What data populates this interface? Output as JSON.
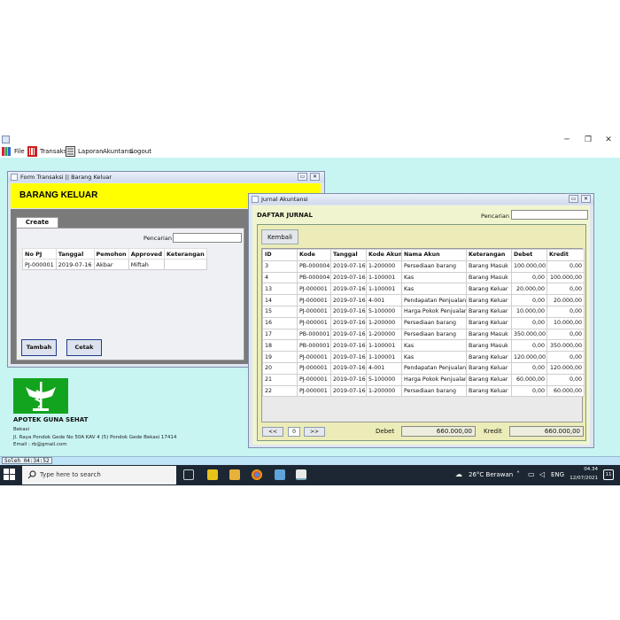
{
  "app": {
    "menu": [
      {
        "label": "File",
        "icon": "books-icon"
      },
      {
        "label": "Transaksi",
        "icon": "barcode-icon"
      },
      {
        "label": "Laporan",
        "icon": "report-icon"
      },
      {
        "label": "Akuntansi",
        "icon": null
      },
      {
        "label": "Logout",
        "icon": null
      }
    ],
    "window_controls": [
      "─",
      "❐",
      "✕"
    ]
  },
  "barang_keluar": {
    "window_title": "Form Transaksi || Barang Keluar",
    "header": "BARANG KELUAR",
    "tab": "Create",
    "search_label": "Pencarian",
    "table": {
      "columns": [
        "No PJ",
        "Tanggal",
        "Pemohon",
        "Approved",
        "Keterangan"
      ],
      "rows": [
        [
          "PJ-000001",
          "2019-07-16",
          "Akbar",
          "Miftah",
          ""
        ]
      ]
    },
    "buttons": {
      "tambah": "Tambah",
      "cetak": "Cetak"
    }
  },
  "company": {
    "name": "APOTEK GUNA SEHAT",
    "city": "Bekasi",
    "address": "Jl. Raya Pondok Gede No 50A KAV 4 (5) Pondok Gede Bekasi 17414",
    "email": "Email : rb@gmail.com"
  },
  "jurnal": {
    "window_title": "Jurnal Akuntansi",
    "title": "DAFTAR JURNAL",
    "search_label": "Pencarian",
    "back_button": "Kembali",
    "columns": [
      "ID",
      "Kode",
      "Tanggal",
      "Kode Akun",
      "Nama Akun",
      "Keterangan",
      "Debet",
      "Kredit"
    ],
    "rows": [
      [
        "3",
        "PB-000004",
        "2019-07-16",
        "1-200000",
        "Persediaan barang",
        "Barang Masuk",
        "100.000,00",
        "0,00"
      ],
      [
        "4",
        "PB-000004",
        "2019-07-16",
        "1-100001",
        "Kas",
        "Barang Masuk",
        "0,00",
        "100.000,00"
      ],
      [
        "13",
        "PJ-000001",
        "2019-07-16",
        "1-100001",
        "Kas",
        "Barang Keluar",
        "20.000,00",
        "0,00"
      ],
      [
        "14",
        "PJ-000001",
        "2019-07-16",
        "4-001",
        "Pendapatan Penjualan",
        "Barang Keluar",
        "0,00",
        "20.000,00"
      ],
      [
        "15",
        "PJ-000001",
        "2019-07-16",
        "5-100000",
        "Harga Pokok Penjualan",
        "Barang Keluar",
        "10.000,00",
        "0,00"
      ],
      [
        "16",
        "PJ-000001",
        "2019-07-16",
        "1-200000",
        "Persediaan barang",
        "Barang Keluar",
        "0,00",
        "10.000,00"
      ],
      [
        "17",
        "PB-000001",
        "2019-07-16",
        "1-200000",
        "Persediaan barang",
        "Barang Masuk",
        "350.000,00",
        "0,00"
      ],
      [
        "18",
        "PB-000001",
        "2019-07-16",
        "1-100001",
        "Kas",
        "Barang Masuk",
        "0,00",
        "350.000,00"
      ],
      [
        "19",
        "PJ-000001",
        "2019-07-16",
        "1-100001",
        "Kas",
        "Barang Keluar",
        "120.000,00",
        "0,00"
      ],
      [
        "20",
        "PJ-000001",
        "2019-07-16",
        "4-001",
        "Pendapatan Penjualan",
        "Barang Keluar",
        "0,00",
        "120.000,00"
      ],
      [
        "21",
        "PJ-000001",
        "2019-07-16",
        "5-100000",
        "Harga Pokok Penjualan",
        "Barang Keluar",
        "60.000,00",
        "0,00"
      ],
      [
        "22",
        "PJ-000001",
        "2019-07-16",
        "1-200000",
        "Persediaan barang",
        "Barang Keluar",
        "0,00",
        "60.000,00"
      ]
    ],
    "pager": {
      "prev": "<<",
      "page": "0",
      "next": ">>"
    },
    "totals": {
      "debet_label": "Debet",
      "debet": "660.000,00",
      "kredit_label": "Kredit",
      "kredit": "660.000,00"
    }
  },
  "status": {
    "user": "Soleh",
    "time": "04:34:52"
  },
  "taskbar": {
    "search_placeholder": "Type here to search",
    "weather": "26°C Berawan",
    "lang": "ENG",
    "clock_time": "04.34",
    "clock_date": "12/07/2021",
    "notifications": "11"
  },
  "colors": {
    "desktop": "#c8f5f2",
    "header_yellow": "#ffff00",
    "jurnal_bg": "#f1f5cf",
    "logo_green": "#13a41f"
  }
}
